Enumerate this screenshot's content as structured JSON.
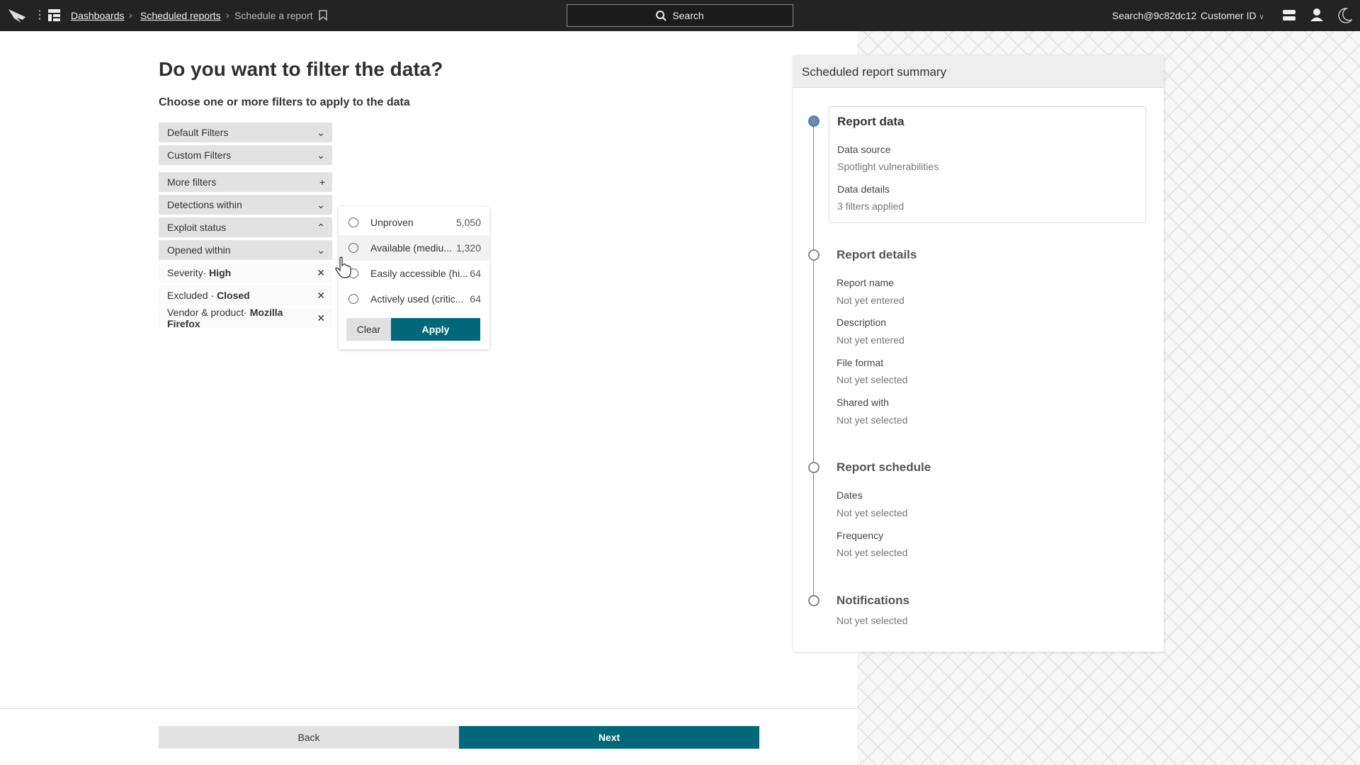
{
  "topbar": {
    "breadcrumbs": [
      "Dashboards",
      "Scheduled reports"
    ],
    "current": "Schedule a report",
    "search": "Search",
    "user": "Search@9c82dc12",
    "customer": "Customer ID"
  },
  "main": {
    "title": "Do you want to filter the data?",
    "subtitle": "Choose one or more filters to apply to the data",
    "filters": [
      "Default Filters",
      "Custom Filters",
      "More filters",
      "Detections within",
      "Exploit status",
      "Opened within"
    ],
    "chips": [
      {
        "key": "Severity·",
        "value": "High"
      },
      {
        "key": "Excluded ·",
        "value": "Closed"
      },
      {
        "key": "Vendor & product·",
        "value": "Mozilla Firefox"
      }
    ],
    "back": "Back",
    "next": "Next"
  },
  "popup": {
    "options": [
      {
        "label": "Unproven",
        "count": "5,050"
      },
      {
        "label": "Available (mediu...",
        "count": "1,320"
      },
      {
        "label": "Easily accessible (hi...",
        "count": "64"
      },
      {
        "label": "Actively used (critic...",
        "count": "64"
      }
    ],
    "clear": "Clear",
    "apply": "Apply"
  },
  "summary": {
    "title": "Scheduled report summary",
    "report_data": {
      "title": "Report data",
      "source_label": "Data source",
      "source": "Spotlight vulnerabilities",
      "details_label": "Data details",
      "details": "3 filters applied"
    },
    "report_details": {
      "title": "Report details",
      "fields": [
        {
          "label": "Report name",
          "value": "Not yet entered"
        },
        {
          "label": "Description",
          "value": "Not yet entered"
        },
        {
          "label": "File format",
          "value": "Not yet selected"
        },
        {
          "label": "Shared with",
          "value": "Not yet selected"
        }
      ]
    },
    "report_schedule": {
      "title": "Report schedule",
      "fields": [
        {
          "label": "Dates",
          "value": "Not yet selected"
        },
        {
          "label": "Frequency",
          "value": "Not yet selected"
        }
      ]
    },
    "notifications": {
      "title": "Notifications",
      "value": "Not yet selected"
    }
  },
  "colors": {
    "accent": "#006879",
    "topbar": "#232323",
    "active_step": "#4e7fd4"
  }
}
